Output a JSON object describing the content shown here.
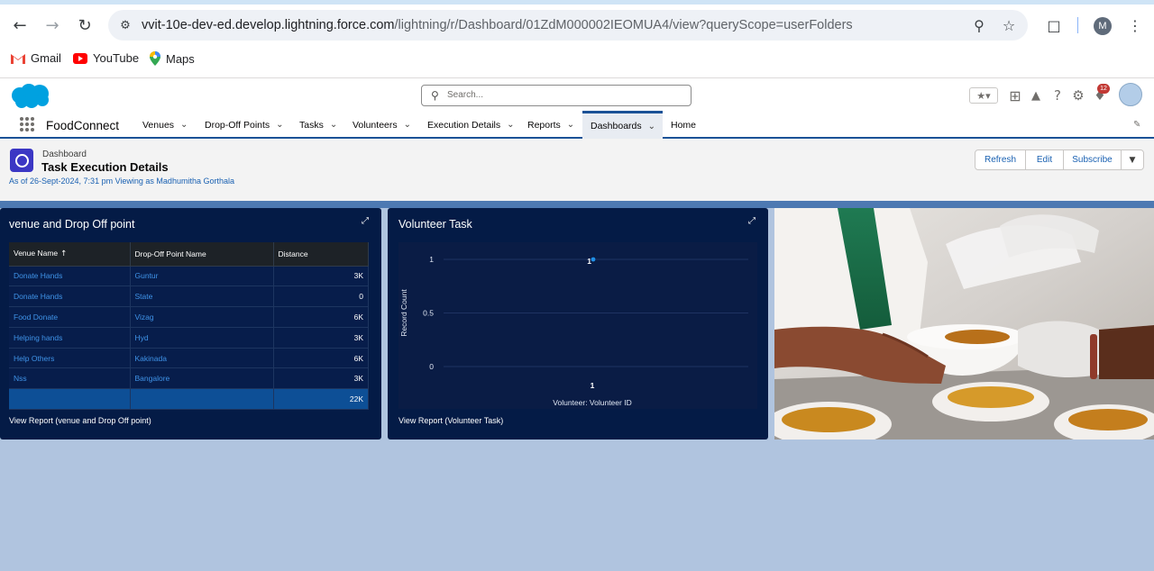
{
  "browser": {
    "url_domain": "vvit-10e-dev-ed.develop.lightning.force.com",
    "url_path": "/lightning/r/Dashboard/01ZdM000002IEOMUA4/view?queryScope=userFolders",
    "profile_initial": "M",
    "bookmarks": [
      "Gmail",
      "YouTube",
      "Maps"
    ]
  },
  "sf": {
    "search_placeholder": "Search...",
    "notification_count": "12",
    "app_name": "FoodConnect",
    "nav": [
      {
        "label": "Venues"
      },
      {
        "label": "Drop-Off Points"
      },
      {
        "label": "Tasks"
      },
      {
        "label": "Volunteers"
      },
      {
        "label": "Execution Details"
      },
      {
        "label": "Reports"
      },
      {
        "label": "Dashboards"
      },
      {
        "label": "Home"
      }
    ]
  },
  "dashboard": {
    "kicker": "Dashboard",
    "title": "Task Execution Details",
    "as_of": "As of 26-Sept-2024, 7:31 pm Viewing as Madhumitha Gorthala",
    "buttons": {
      "refresh": "Refresh",
      "edit": "Edit",
      "subscribe": "Subscribe"
    }
  },
  "widgets": {
    "table": {
      "title": "venue and Drop Off point",
      "headers": [
        "Venue Name",
        "Drop-Off Point Name",
        "Distance"
      ],
      "rows": [
        [
          "Donate Hands",
          "Guntur",
          "3K"
        ],
        [
          "Donate Hands",
          "State",
          "0"
        ],
        [
          "Food Donate",
          "Vizag",
          "6K"
        ],
        [
          "Helping hands",
          "Hyd",
          "3K"
        ],
        [
          "Help Others",
          "Kakinada",
          "6K"
        ],
        [
          "Nss",
          "Bangalore",
          "3K"
        ]
      ],
      "total": "22K",
      "view_report": "View Report (venue and Drop Off point)"
    },
    "chart": {
      "title": "Volunteer Task",
      "view_report": "View Report (Volunteer Task)"
    }
  },
  "chart_data": {
    "type": "scatter",
    "title": "Volunteer Task",
    "xlabel": "Volunteer: Volunteer ID",
    "ylabel": "Record Count",
    "categories": [
      "1"
    ],
    "values": [
      1
    ],
    "data_labels": [
      "1"
    ],
    "y_ticks": [
      "1",
      "0.5",
      "0"
    ],
    "ylim": [
      0,
      1
    ],
    "grid": true,
    "colors": {
      "point": "#1f8fe6",
      "background": "#0a1c45",
      "grid": "#1f3363"
    }
  },
  "colors": {
    "brand": "#00a1e0",
    "nav_accent": "#1b5297",
    "panel_bg": "#041b46",
    "link": "#3f93e8"
  }
}
